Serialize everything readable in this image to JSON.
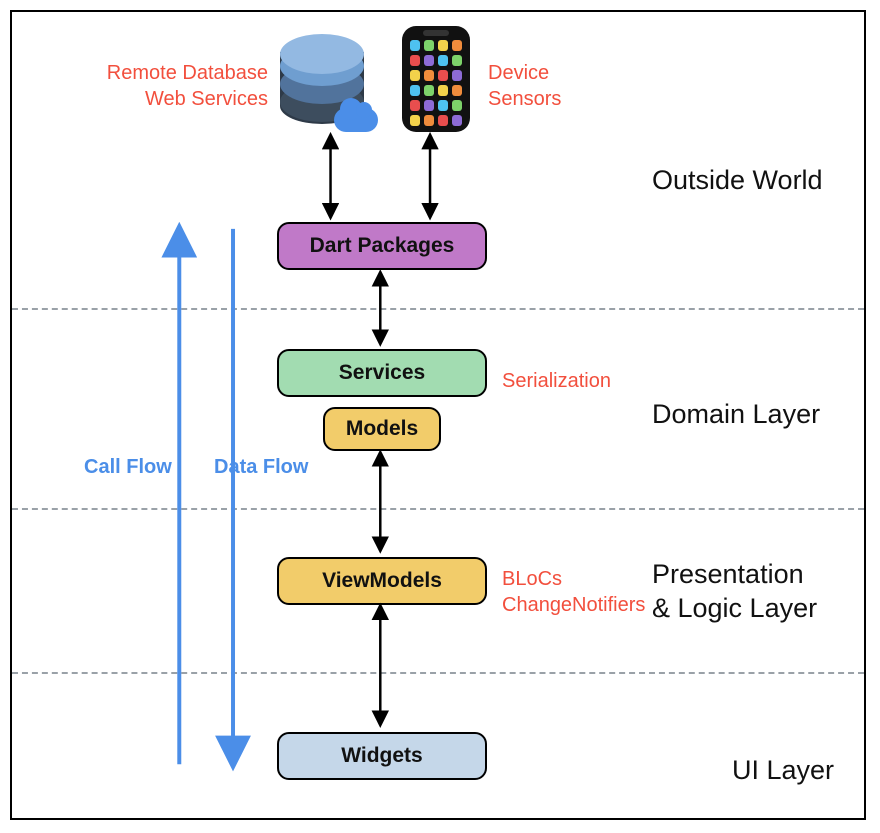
{
  "layers": {
    "outside": "Outside World",
    "domain": "Domain Layer",
    "presentation_line1": "Presentation",
    "presentation_line2": "& Logic Layer",
    "ui": "UI Layer"
  },
  "boxes": {
    "dart_packages": "Dart Packages",
    "services": "Services",
    "models": "Models",
    "viewmodels": "ViewModels",
    "widgets": "Widgets"
  },
  "annotations": {
    "remote_db_line1": "Remote Database",
    "remote_db_line2": "Web Services",
    "device_line1": "Device",
    "device_line2": "Sensors",
    "serialization": "Serialization",
    "blocs_line1": "BLoCs",
    "blocs_line2": "ChangeNotifiers"
  },
  "flows": {
    "call": "Call Flow",
    "data": "Data Flow"
  },
  "phone_app_colors": [
    "#4ec2f0",
    "#7dd36a",
    "#f3d24b",
    "#f08c3c",
    "#e94e4e",
    "#8d6bd6",
    "#4ec2f0",
    "#7dd36a",
    "#f3d24b",
    "#f08c3c",
    "#e94e4e",
    "#8d6bd6",
    "#4ec2f0",
    "#7dd36a",
    "#f3d24b",
    "#f08c3c",
    "#e94e4e",
    "#8d6bd6",
    "#4ec2f0",
    "#7dd36a",
    "#f3d24b",
    "#f08c3c",
    "#e94e4e",
    "#8d6bd6"
  ],
  "colors": {
    "purple": "#c079c8",
    "green": "#a2dcb1",
    "yellow": "#f2cc6a",
    "blue_box": "#c5d7e9",
    "arrow_blue": "#4b8ee8",
    "accent_red": "#f24f3d"
  }
}
